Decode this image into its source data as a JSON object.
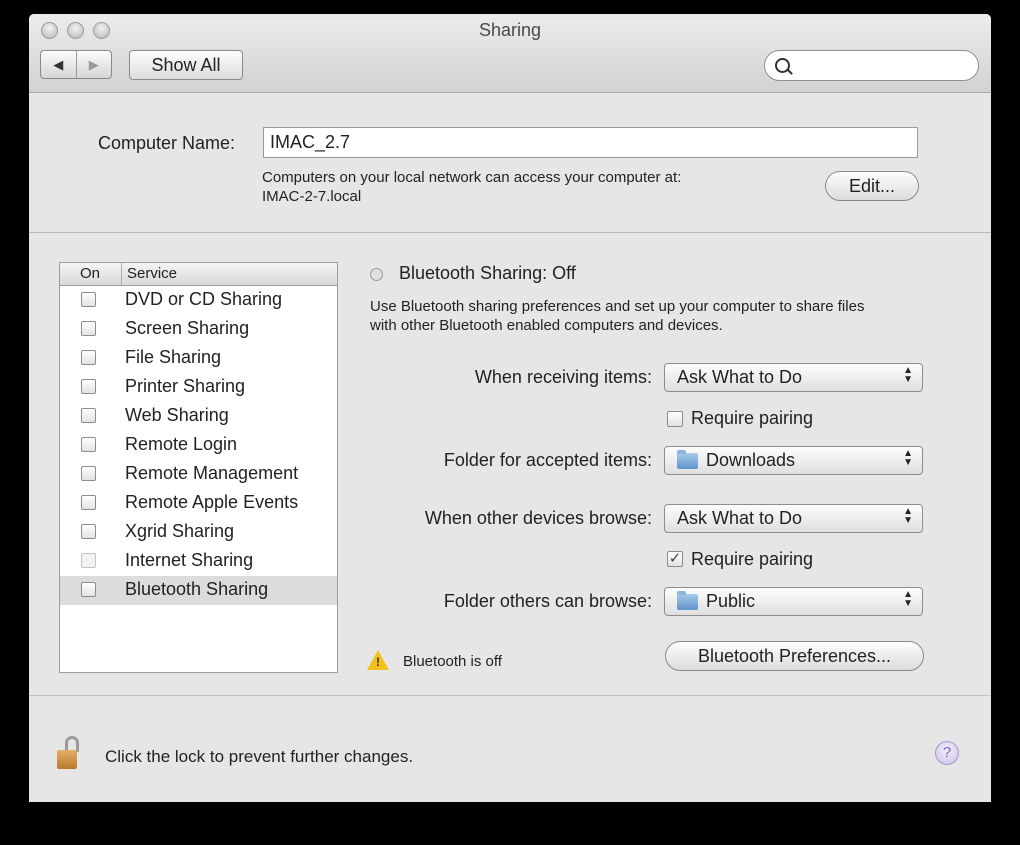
{
  "window": {
    "title": "Sharing"
  },
  "toolbar": {
    "back_icon": "◀",
    "forward_icon": "▶",
    "show_all": "Show All",
    "search_placeholder": ""
  },
  "computer_name": {
    "label": "Computer Name:",
    "value": "IMAC_2.7",
    "info_line1": "Computers on your local network can access your computer at:",
    "info_line2": "IMAC-2-7.local",
    "edit_button": "Edit..."
  },
  "services": {
    "header_on": "On",
    "header_service": "Service",
    "items": [
      {
        "label": "DVD or CD Sharing",
        "checked": false
      },
      {
        "label": "Screen Sharing",
        "checked": false
      },
      {
        "label": "File Sharing",
        "checked": false
      },
      {
        "label": "Printer Sharing",
        "checked": false
      },
      {
        "label": "Web Sharing",
        "checked": false
      },
      {
        "label": "Remote Login",
        "checked": false
      },
      {
        "label": "Remote Management",
        "checked": false
      },
      {
        "label": "Remote Apple Events",
        "checked": false
      },
      {
        "label": "Xgrid Sharing",
        "checked": false
      },
      {
        "label": "Internet Sharing",
        "checked": false,
        "disabled": true
      },
      {
        "label": "Bluetooth Sharing",
        "checked": false,
        "selected": true
      }
    ]
  },
  "detail": {
    "status": "Bluetooth Sharing: Off",
    "desc_line1": "Use Bluetooth sharing preferences and set up your computer to share files",
    "desc_line2": "with other Bluetooth enabled computers and devices.",
    "receiving_label": "When receiving items:",
    "receiving_value": "Ask What to Do",
    "require_pairing_1": "Require pairing",
    "require_pairing_1_checked": false,
    "folder_accepted_label": "Folder for accepted items:",
    "folder_accepted_value": "Downloads",
    "browse_label": "When other devices browse:",
    "browse_value": "Ask What to Do",
    "require_pairing_2": "Require pairing",
    "require_pairing_2_checked": true,
    "folder_browse_label": "Folder others can browse:",
    "folder_browse_value": "Public",
    "warning": "Bluetooth is off",
    "prefs_button": "Bluetooth Preferences..."
  },
  "footer": {
    "lock_text": "Click the lock to prevent further changes.",
    "help": "?"
  }
}
